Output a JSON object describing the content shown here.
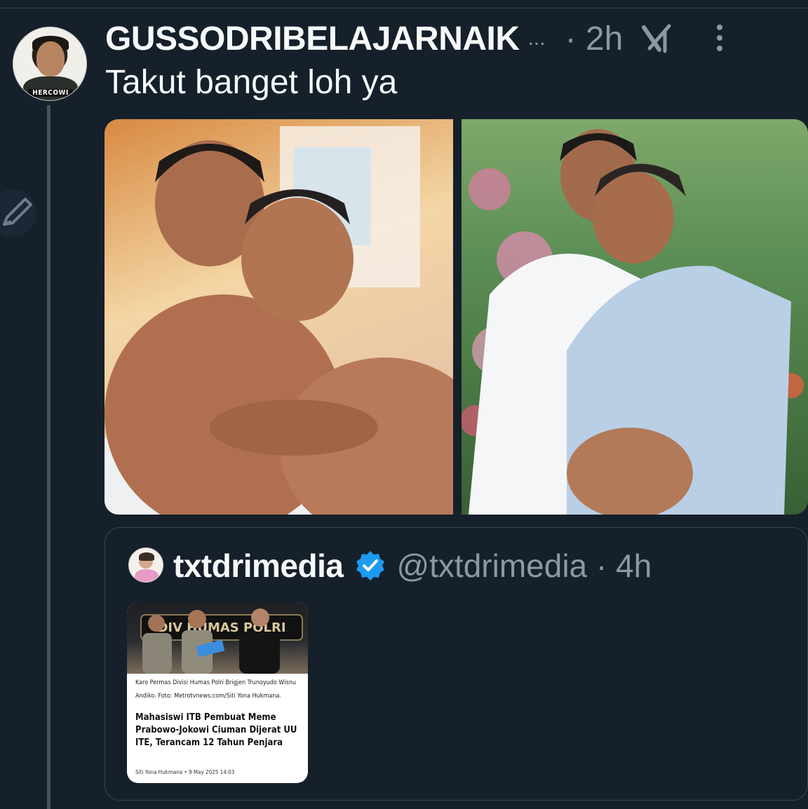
{
  "tweet": {
    "display_name": "GUSSODRIBELAJARNAIK",
    "name_overflow": "...",
    "time": "· 2h",
    "text": "Takut banget loh ya",
    "avatar_caption": "HERCOWI"
  },
  "icons": {
    "grok": "grok-icon",
    "more": "more-vertical-icon",
    "compose": "compose-pencil-icon",
    "verified": "verified-badge-icon"
  },
  "colors": {
    "background": "#15202b",
    "text_primary": "#f7f9f9",
    "text_secondary": "#8b98a5",
    "border": "#38444d",
    "verified_blue": "#1d9bf0"
  },
  "quote": {
    "display_name": "txtdrimedia",
    "handle_time": "@txtdrimedia · 4h",
    "thumbnail": {
      "sign_text": "DIV HUMAS POLRI",
      "caption": "Karo Permas Divisi Humas Polri Brigjen Trunoyudo Wisnu Andiko. Foto: Metrotvnews.com/Siti Yona Hukmana.",
      "headline": "Mahasiswi ITB Pembuat Meme Prabowo-Jokowi Ciuman Dijerat UU ITE, Terancam 12 Tahun Penjara",
      "byline": "Siti Yona Hukmana • 9 May 2025 14:03"
    }
  }
}
